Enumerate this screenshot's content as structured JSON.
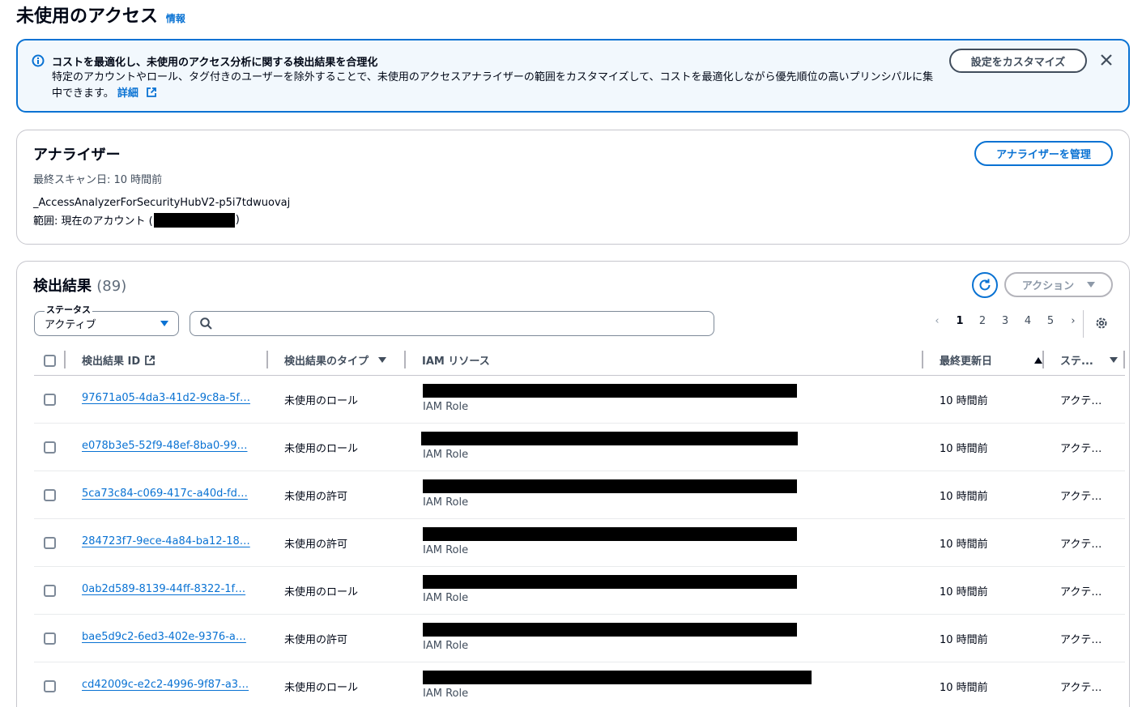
{
  "page": {
    "title": "未使用のアクセス",
    "info_link": "情報"
  },
  "banner": {
    "title": "コストを最適化し、未使用のアクセス分析に関する検出結果を合理化",
    "body": "特定のアカウントやロール、タグ付きのユーザーを除外することで、未使用のアクセスアナライザーの範囲をカスタマイズして、コストを最適化しながら優先順位の高いプリンシパルに集中できます。",
    "link": "詳細",
    "customize_button": "設定をカスタマイズ",
    "icons": {
      "info": "info-circle-icon",
      "external": "external-link-icon",
      "close": "close-icon"
    }
  },
  "analyzer": {
    "title": "アナライザー",
    "last_scan": "最終スキャン日: 10 時間前",
    "name": "_AccessAnalyzerForSecurityHubV2-p5i7tdwuovaj",
    "scope_label": "範囲: 現在のアカウント (",
    "scope_close": ")",
    "manage_button": "アナライザーを管理"
  },
  "findings": {
    "title": "検出結果",
    "count": "(89)",
    "actions_button": "アクション",
    "status_label": "ステータス",
    "status_value": "アクティブ",
    "search_placeholder": "",
    "pagination": {
      "pages": [
        "1",
        "2",
        "3",
        "4",
        "5"
      ],
      "current": "1"
    },
    "columns": {
      "id": "検出結果 ID",
      "type": "検出結果のタイプ",
      "resource": "IAM リソース",
      "updated": "最終更新日",
      "status": "ステ..."
    },
    "rows": [
      {
        "id": "97671a05-4da3-41d2-9c8a-5f…",
        "type": "未使用のロール",
        "resource_sub": "IAM Role",
        "updated": "10 時間前",
        "status": "アクテ…"
      },
      {
        "id": "e078b3e5-52f9-48ef-8ba0-99…",
        "type": "未使用のロール",
        "resource_sub": "IAM Role",
        "updated": "10 時間前",
        "status": "アクテ…"
      },
      {
        "id": "5ca73c84-c069-417c-a40d-fd…",
        "type": "未使用の許可",
        "resource_sub": "IAM Role",
        "updated": "10 時間前",
        "status": "アクテ…"
      },
      {
        "id": "284723f7-9ece-4a84-ba12-18…",
        "type": "未使用の許可",
        "resource_sub": "IAM Role",
        "updated": "10 時間前",
        "status": "アクテ…"
      },
      {
        "id": "0ab2d589-8139-44ff-8322-1f…",
        "type": "未使用のロール",
        "resource_sub": "IAM Role",
        "updated": "10 時間前",
        "status": "アクテ…"
      },
      {
        "id": "bae5d9c2-6ed3-402e-9376-a…",
        "type": "未使用の許可",
        "resource_sub": "IAM Role",
        "updated": "10 時間前",
        "status": "アクテ…"
      },
      {
        "id": "cd42009c-e2c2-4996-9f87-a3…",
        "type": "未使用のロール",
        "resource_sub": "IAM Role",
        "updated": "10 時間前",
        "status": "アクテ…"
      }
    ]
  },
  "colors": {
    "accent": "#0972d3",
    "banner_bg": "#f2f8fd",
    "text": "#000716",
    "muted": "#414d5c"
  }
}
